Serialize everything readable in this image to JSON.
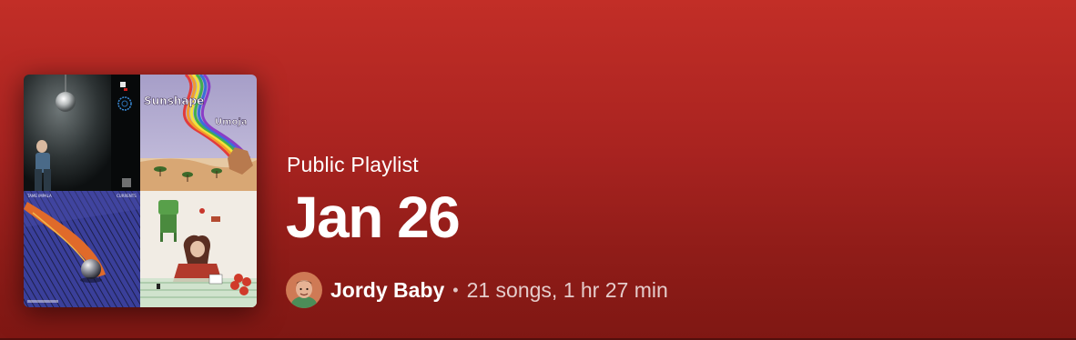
{
  "playlist": {
    "type_label": "Public Playlist",
    "title": "Jan 26",
    "owner_name": "Jordy Baby",
    "separator": "•",
    "stats": "21 songs, 1 hr 27 min"
  },
  "cover": {
    "tiles": [
      {
        "name": "cover-tile-disco-ball",
        "text": ""
      },
      {
        "name": "cover-tile-sunshape",
        "text_top": "Sunshape",
        "text_sub": "Umoja"
      },
      {
        "name": "cover-tile-pinball",
        "text_left": "TAME IMPALA",
        "text_right": "CURRENTS"
      },
      {
        "name": "cover-tile-girl-table",
        "text": ""
      }
    ]
  },
  "colors": {
    "gradient_top": "#c22e27",
    "gradient_bottom": "#7f1713",
    "text_primary": "#ffffff"
  }
}
